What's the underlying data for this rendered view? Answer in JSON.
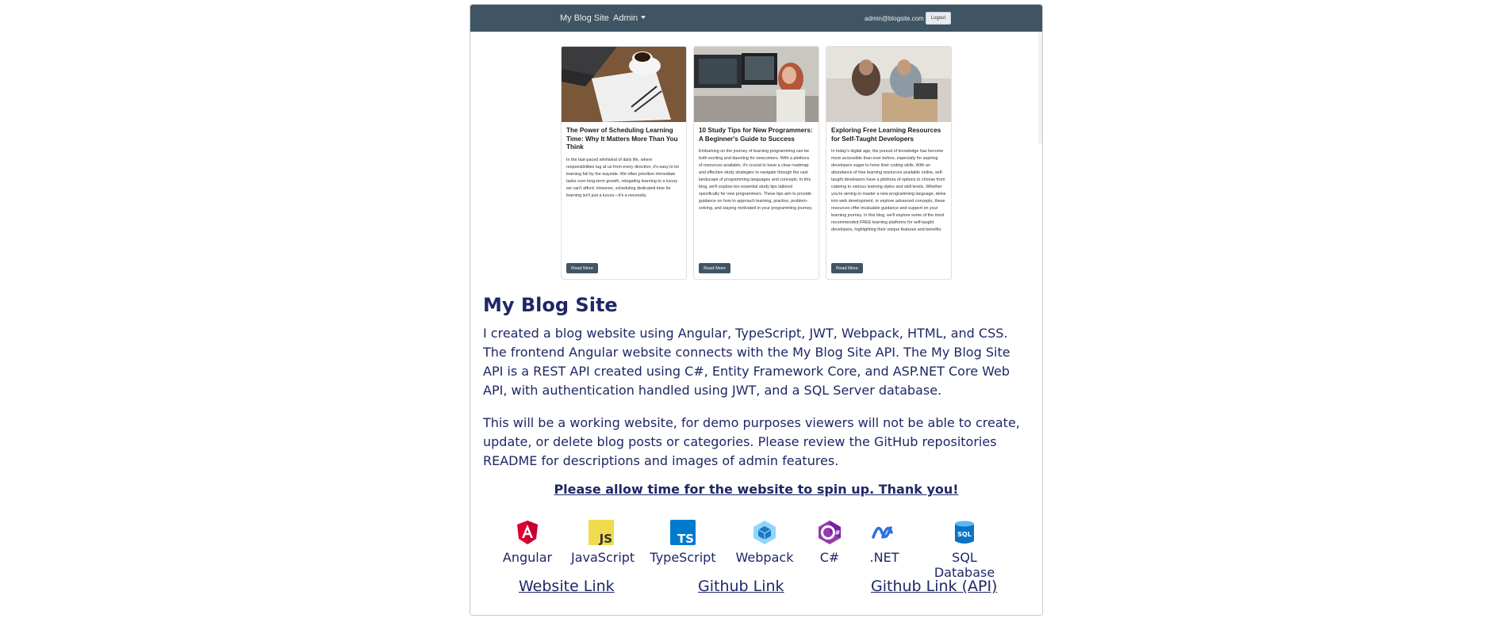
{
  "preview": {
    "nav": {
      "brand": "My Blog Site",
      "admin": "Admin",
      "email": "admin@blogsite.com",
      "logout": "Logout"
    },
    "cards": [
      {
        "title": "The Power of Scheduling Learning Time: Why It Matters More Than You Think",
        "excerpt": "In the fast-paced whirlwind of daily life, where responsibilities tug at us from every direction, it's easy to let learning fall by the wayside. We often prioritize immediate tasks over long-term growth, relegating learning to a luxury we can't afford. However, scheduling dedicated time for learning isn't just a luxury—it's a necessity.",
        "button": "Read More"
      },
      {
        "title": "10 Study Tips for New Programmers: A Beginner's Guide to Success",
        "excerpt": "Embarking on the journey of learning programming can be both exciting and daunting for newcomers. With a plethora of resources available, it's crucial to have a clear roadmap and effective study strategies to navigate through the vast landscape of programming languages and concepts. In this blog, we'll explore ten essential study tips tailored specifically for new programmers. These tips aim to provide guidance on how to approach learning, practice, problem-solving, and staying motivated in your programming journey.",
        "button": "Read More"
      },
      {
        "title": "Exploring Free Learning Resources for Self-Taught Developers",
        "excerpt": "In today's digital age, the pursuit of knowledge has become more accessible than ever before, especially for aspiring developers eager to hone their coding skills. With an abundance of free learning resources available online, self-taught developers have a plethora of options to choose from catering to various learning styles and skill levels. Whether you're aiming to master a new programming language, delve into web development, or explore advanced concepts, these resources offer invaluable guidance and support on your learning journey. In this blog, we'll explore some of the most recommended FREE learning platforms for self-taught developers, highlighting their unique features and benefits.",
        "button": "Read More"
      }
    ]
  },
  "project": {
    "title": "My Blog Site",
    "paragraph1": "I created a blog website using Angular, TypeScript, JWT, Webpack, HTML, and CSS. The frontend Angular website connects with the My Blog Site API. The My Blog Site API is a REST API created using C#, Entity Framework Core, and ASP.NET Core Web API, with authentication handled using JWT, and a SQL Server database.",
    "paragraph2": "This will be a working website, for demo purposes viewers will not be able to create, update, or delete blog posts or categories. Please review the GitHub repositories README for descriptions and images of admin features.",
    "notice": "Please allow time for the website to spin up. Thank you!",
    "technologies": [
      {
        "label": "Angular",
        "icon": "angular-icon"
      },
      {
        "label": "JavaScript",
        "icon": "javascript-icon"
      },
      {
        "label": "TypeScript",
        "icon": "typescript-icon"
      },
      {
        "label": "Webpack",
        "icon": "webpack-icon"
      },
      {
        "label": "C#",
        "icon": "csharp-icon"
      },
      {
        "label": ".NET",
        "icon": "dotnet-icon"
      },
      {
        "label": "SQL Database",
        "icon": "sql-database-icon"
      }
    ],
    "links": {
      "website": "Website Link",
      "github": "Github Link",
      "github_api": "Github Link (API)"
    }
  },
  "colors": {
    "nav": "#3f5564",
    "text": "#1e2766",
    "angular": "#dd0031",
    "javascript": "#f0db4f",
    "typescript": "#007acc",
    "webpack": "#1c78c0",
    "csharp": "#953dac",
    "dotnet": "#2f6fde",
    "sql": "#0a73c7"
  }
}
